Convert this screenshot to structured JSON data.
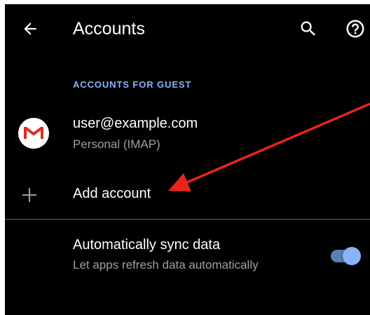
{
  "header": {
    "title": "Accounts",
    "back_icon": "arrow-left-icon",
    "search_icon": "search-icon",
    "help_icon": "help-icon"
  },
  "section": {
    "header": "ACCOUNTS FOR GUEST"
  },
  "account": {
    "email": "user@example.com",
    "type": "Personal (IMAP)",
    "avatar_icon": "gmail-icon"
  },
  "add_account": {
    "label": "Add account",
    "icon": "plus-icon"
  },
  "sync": {
    "title": "Automatically sync data",
    "subtitle": "Let apps refresh data automatically",
    "enabled": true
  },
  "colors": {
    "background": "#000000",
    "accent": "#8ab4f8",
    "annotation_arrow": "#e8251b"
  }
}
